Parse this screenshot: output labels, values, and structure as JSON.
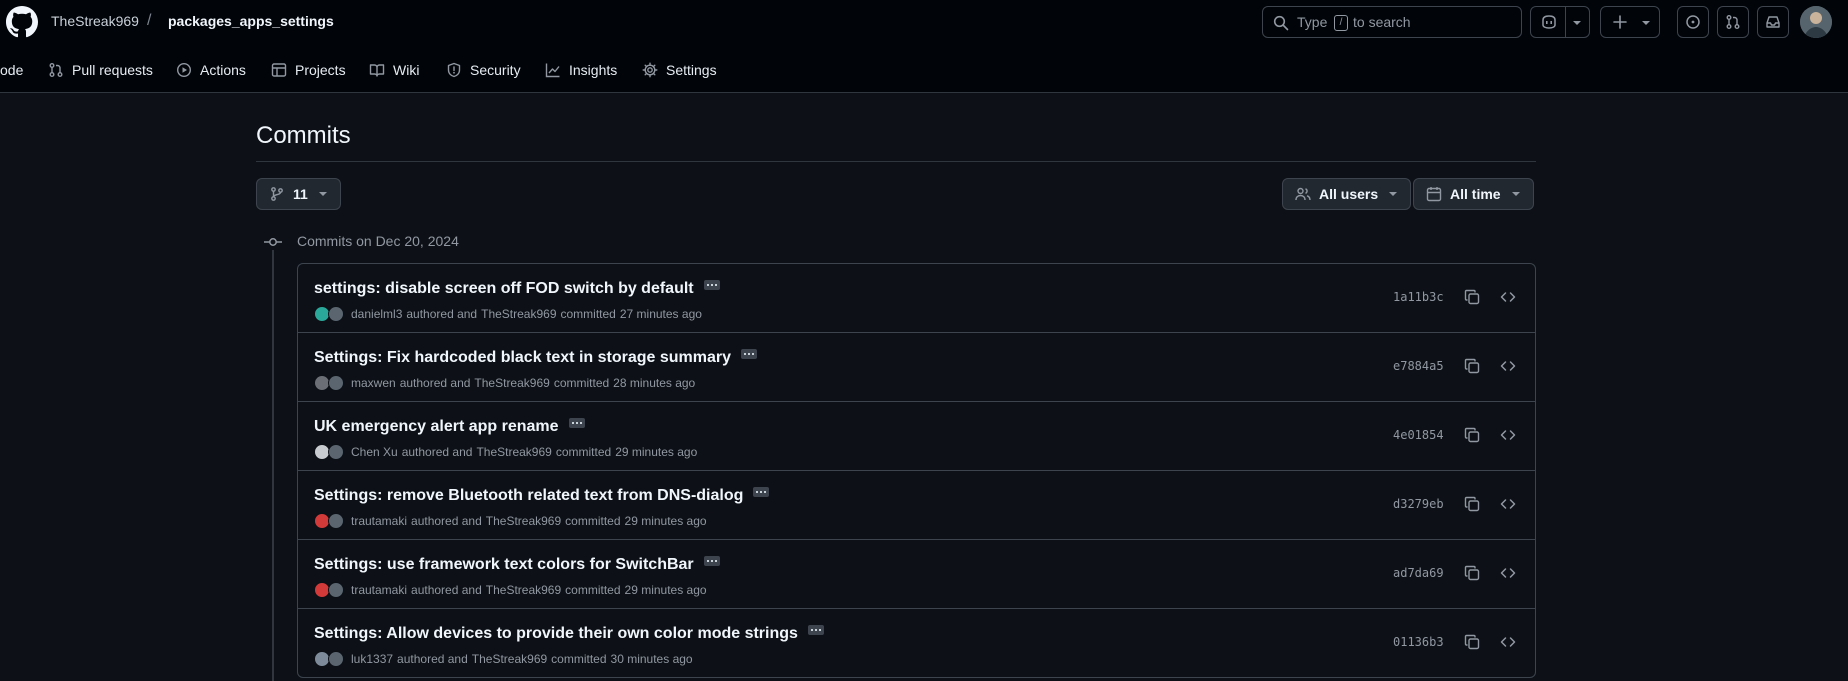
{
  "header": {
    "owner": "TheStreak969",
    "separator": "/",
    "repo": "packages_apps_settings",
    "search": {
      "prefix": "Type",
      "key": "/",
      "suffix": "to search"
    },
    "icons": [
      "copilot-icon",
      "plus-icon",
      "issue-icon",
      "pull-request-icon",
      "inbox-icon"
    ]
  },
  "nav": {
    "items": [
      {
        "label": "ode",
        "icon": "code-icon"
      },
      {
        "label": "Pull requests",
        "icon": "pull-request-icon"
      },
      {
        "label": "Actions",
        "icon": "play-icon"
      },
      {
        "label": "Projects",
        "icon": "table-icon"
      },
      {
        "label": "Wiki",
        "icon": "book-icon"
      },
      {
        "label": "Security",
        "icon": "shield-icon"
      },
      {
        "label": "Insights",
        "icon": "graph-icon"
      },
      {
        "label": "Settings",
        "icon": "gear-icon"
      }
    ]
  },
  "main": {
    "title": "Commits",
    "branch_label": "11",
    "users_label": "All users",
    "time_label": "All time",
    "group_title": "Commits on Dec 20, 2024",
    "authored_text": "authored and",
    "committed_text": "committed",
    "commits": [
      {
        "title": "settings: disable screen off FOD switch by default",
        "author": "danielml3",
        "committer": "TheStreak969",
        "time": "27 minutes ago",
        "sha": "1a11b3c",
        "author_color": "#2aa89a"
      },
      {
        "title": "Settings: Fix hardcoded black text in storage summary",
        "author": "maxwen",
        "committer": "TheStreak969",
        "time": "28 minutes ago",
        "sha": "e7884a5",
        "author_color": "#6b6f75"
      },
      {
        "title": "UK emergency alert app rename",
        "author": "Chen Xu",
        "committer": "TheStreak969",
        "time": "29 minutes ago",
        "sha": "4e01854",
        "author_color": "#c8ccd0"
      },
      {
        "title": "Settings: remove Bluetooth related text from DNS-dialog",
        "author": "trautamaki",
        "committer": "TheStreak969",
        "time": "29 minutes ago",
        "sha": "d3279eb",
        "author_color": "#d23a3a"
      },
      {
        "title": "Settings: use framework text colors for SwitchBar",
        "author": "trautamaki",
        "committer": "TheStreak969",
        "time": "29 minutes ago",
        "sha": "ad7da69",
        "author_color": "#d23a3a"
      },
      {
        "title": "Settings: Allow devices to provide their own color mode strings",
        "author": "luk1337",
        "committer": "TheStreak969",
        "time": "30 minutes ago",
        "sha": "01136b3",
        "author_color": "#7c8a9a"
      }
    ]
  }
}
